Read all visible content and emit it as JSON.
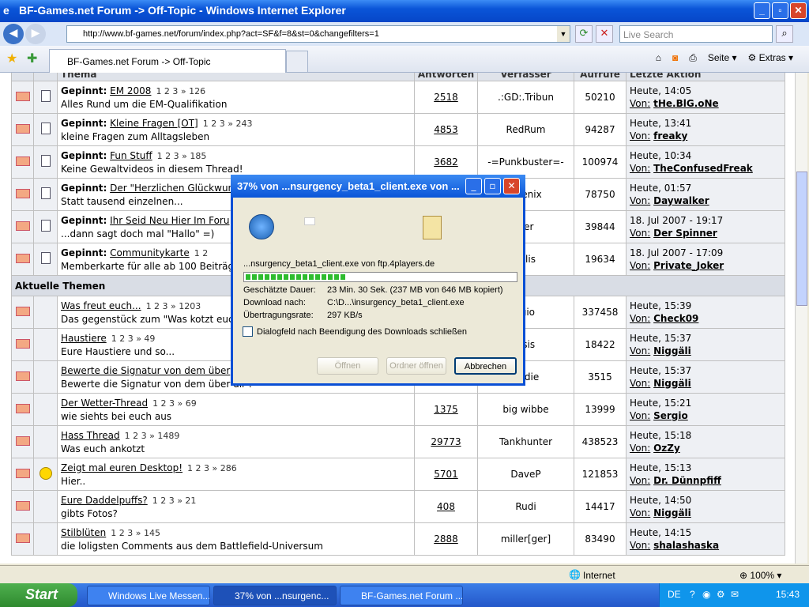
{
  "window": {
    "title": "BF-Games.net Forum -> Off-Topic - Windows Internet Explorer"
  },
  "address": {
    "url": "http://www.bf-games.net/forum/index.php?act=SF&f=8&st=0&changefilters=1",
    "search_placeholder": "Live Search"
  },
  "tab": {
    "label": "BF-Games.net Forum -> Off-Topic"
  },
  "toolbar": {
    "page_label": "Seite",
    "extras_label": "Extras"
  },
  "table": {
    "headers": [
      "Thema",
      "Antworten",
      "Verfasser",
      "Aufrufe",
      "Letzte Aktion"
    ],
    "section_label": "Aktuelle Themen",
    "pinned_prefix": "Gepinnt:",
    "by_label": "Von:",
    "pinned": [
      {
        "title": "EM 2008",
        "pages": "1 2 3 » 126",
        "desc": "Alles Rund um die EM-Qualifikation",
        "replies": "2518",
        "author": ".:GD:.Tribun",
        "views": "50210",
        "last_time": "Heute, 14:05",
        "last_user": "tHe.BlG.oNe"
      },
      {
        "title": "Kleine Fragen [OT]",
        "pages": "1 2 3 » 243",
        "desc": "kleine Fragen zum Alltagsleben",
        "replies": "4853",
        "author": "RedRum",
        "views": "94287",
        "last_time": "Heute, 13:41",
        "last_user": "freaky"
      },
      {
        "title": "Fun Stuff",
        "pages": "1 2 3 » 185",
        "desc": "Keine Gewaltvideos in diesem Thread!",
        "replies": "3682",
        "author": "-=Punkbuster=-",
        "views": "100974",
        "last_time": "Heute, 10:34",
        "last_user": "TheConfusedFreak"
      },
      {
        "title": "Der \"Herzlichen Glückwun",
        "pages": "",
        "desc": "Statt tausend einzelnen...",
        "replies": "",
        "author": "hoenix",
        "views": "78750",
        "last_time": "Heute, 01:57",
        "last_user": "Daywalker"
      },
      {
        "title": "Ihr Seid Neu Hier Im Foru",
        "pages": "",
        "desc": "...dann sagt doch mal \"Hallo\" =)",
        "replies": "",
        "author": "uer",
        "views": "39844",
        "last_time": "18. Jul 2007 - 19:17",
        "last_user": "Der Spinner"
      },
      {
        "title": "Communitykarte",
        "pages": "1 2",
        "desc": "Memberkarte für alle ab 100 Beiträge",
        "replies": "",
        "author": "talis",
        "views": "19634",
        "last_time": "18. Jul 2007 - 17:09",
        "last_user": "Private_Joker"
      }
    ],
    "current": [
      {
        "title": "Was freut euch...",
        "pages": "1 2 3 » 1203",
        "desc": "Das gegenstück zum \"Was kotzt euch",
        "replies": "",
        "author": "rgio",
        "views": "337458",
        "last_time": "Heute, 15:39",
        "last_user": "Check09",
        "icon": "none"
      },
      {
        "title": "Haustiere",
        "pages": "1 2 3 » 49",
        "desc": "Eure Haustiere und so...",
        "replies": "",
        "author": "osis",
        "views": "18422",
        "last_time": "Heute, 15:37",
        "last_user": "Niggäli",
        "icon": "none"
      },
      {
        "title": "Bewerte die Signatur von dem über",
        "pages": "",
        "desc": "Bewerte die Signatur von dem über dir :",
        "replies": "",
        "author": "Eddie",
        "views": "3515",
        "last_time": "Heute, 15:37",
        "last_user": "Niggäli",
        "icon": "none"
      },
      {
        "title": "Der Wetter-Thread",
        "pages": "1 2 3 » 69",
        "desc": "wie siehts bei euch aus",
        "replies": "1375",
        "author": "big wibbe",
        "views": "13999",
        "last_time": "Heute, 15:21",
        "last_user": "Sergio",
        "icon": "none"
      },
      {
        "title": "Hass Thread",
        "pages": "1 2 3 » 1489",
        "desc": "Was euch ankotzt",
        "replies": "29773",
        "author": "Tankhunter",
        "views": "438523",
        "last_time": "Heute, 15:18",
        "last_user": "OzZy",
        "icon": "none"
      },
      {
        "title": "Zeigt mal euren Desktop!",
        "pages": "1 2 3 » 286",
        "desc": "Hier..",
        "replies": "5701",
        "author": "DaveP",
        "views": "121853",
        "last_time": "Heute, 15:13",
        "last_user": "Dr. Dünnpfiff",
        "icon": "smile"
      },
      {
        "title": "Eure Daddelpuffs?",
        "pages": "1 2 3 » 21",
        "desc": "gibts Fotos?",
        "replies": "408",
        "author": "Rudi",
        "views": "14417",
        "last_time": "Heute, 14:50",
        "last_user": "Niggäli",
        "icon": "none"
      },
      {
        "title": "Stilblüten",
        "pages": "1 2 3 » 145",
        "desc": "die loligsten Comments aus dem Battlefield-Universum",
        "replies": "2888",
        "author": "miller[ger]",
        "views": "83490",
        "last_time": "Heute, 14:15",
        "last_user": "shalashaska",
        "icon": "none"
      }
    ]
  },
  "statusbar": {
    "zone": "Internet",
    "zoom": "100%"
  },
  "dialog": {
    "title": "37% von ...nsurgency_beta1_client.exe von ...",
    "source": "...nsurgency_beta1_client.exe von ftp.4players.de",
    "progress": 0.37,
    "rows": [
      {
        "label": "Geschätzte Dauer:",
        "value": "23 Min. 30 Sek. (237 MB von 646 MB kopiert)"
      },
      {
        "label": "Download nach:",
        "value": "C:\\D...\\insurgency_beta1_client.exe"
      },
      {
        "label": "Übertragungsrate:",
        "value": "297 KB/s"
      }
    ],
    "checkbox_label": "Dialogfeld nach Beendigung des Downloads schließen",
    "open_label": "Öffnen",
    "open_folder_label": "Ordner öffnen",
    "cancel_label": "Abbrechen"
  },
  "taskbar": {
    "start_label": "Start",
    "tasks": [
      "Windows Live Messen...",
      "37% von ...nsurgenc...",
      "BF-Games.net Forum ..."
    ],
    "lang": "DE",
    "clock": "15:43"
  }
}
